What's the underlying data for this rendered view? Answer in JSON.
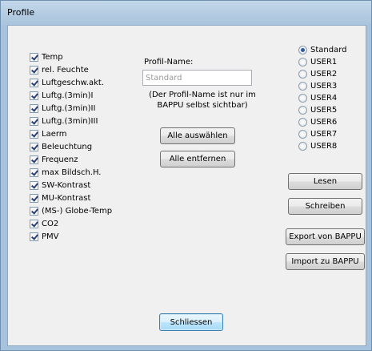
{
  "window": {
    "title": "Profile"
  },
  "checkboxes": [
    {
      "label": "Temp",
      "checked": true
    },
    {
      "label": "rel. Feuchte",
      "checked": true
    },
    {
      "label": "Luftgeschw.akt.",
      "checked": true
    },
    {
      "label": "Luftg.(3min)I",
      "checked": true
    },
    {
      "label": "Luftg.(3min)II",
      "checked": true
    },
    {
      "label": "Luftg.(3min)III",
      "checked": true
    },
    {
      "label": "Laerm",
      "checked": true
    },
    {
      "label": "Beleuchtung",
      "checked": true
    },
    {
      "label": "Frequenz",
      "checked": true
    },
    {
      "label": "max Bildsch.H.",
      "checked": true
    },
    {
      "label": "SW-Kontrast",
      "checked": true
    },
    {
      "label": "MU-Kontrast",
      "checked": true
    },
    {
      "label": "(MS-) Globe-Temp",
      "checked": true
    },
    {
      "label": "CO2",
      "checked": true
    },
    {
      "label": "PMV",
      "checked": true
    }
  ],
  "profile": {
    "name_label": "Profil-Name:",
    "name_value": "Standard",
    "note": "(Der Profil-Name ist nur im BAPPU selbst sichtbar)"
  },
  "buttons": {
    "select_all": "Alle auswählen",
    "remove_all": "Alle entfernen",
    "close": "Schliessen",
    "read": "Lesen",
    "write": "Schreiben",
    "export": "Export von BAPPU",
    "import": "Import zu BAPPU"
  },
  "radios": [
    {
      "label": "Standard",
      "selected": true
    },
    {
      "label": "USER1",
      "selected": false
    },
    {
      "label": "USER2",
      "selected": false
    },
    {
      "label": "USER3",
      "selected": false
    },
    {
      "label": "USER4",
      "selected": false
    },
    {
      "label": "USER5",
      "selected": false
    },
    {
      "label": "USER6",
      "selected": false
    },
    {
      "label": "USER7",
      "selected": false
    },
    {
      "label": "USER8",
      "selected": false
    }
  ]
}
